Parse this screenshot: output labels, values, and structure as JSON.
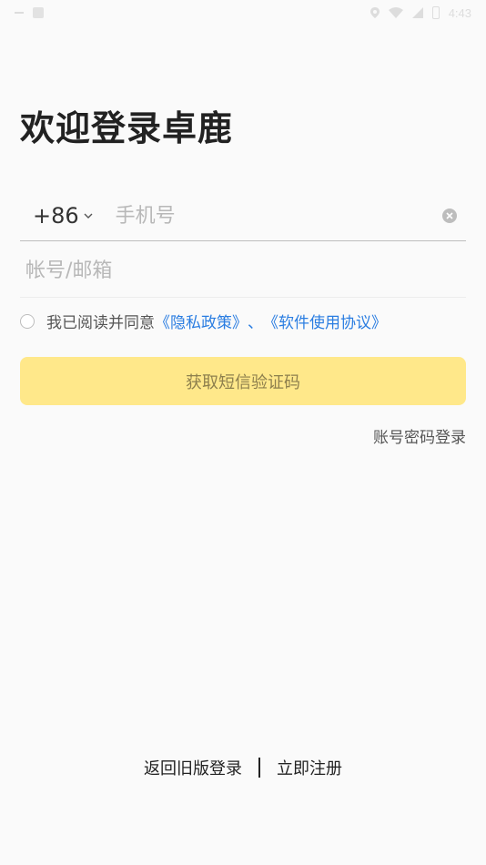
{
  "status_bar": {
    "time": "4:43",
    "icons": [
      "minus-icon",
      "image-icon",
      "location-icon",
      "wifi-icon",
      "signal-icon",
      "battery-icon"
    ]
  },
  "title": "欢迎登录卓鹿",
  "phone": {
    "country_code": "+86",
    "placeholder": "手机号"
  },
  "account": {
    "placeholder": "帐号/邮箱"
  },
  "agreement": {
    "prefix": "我已阅读并同意",
    "privacy_link": "《隐私政策》",
    "separator": "、",
    "terms_link": "《软件使用协议》"
  },
  "sms_button": {
    "label": "获取短信验证码",
    "bg_color": "#ffe88a"
  },
  "password_login": "账号密码登录",
  "bottom": {
    "old_login": "返回旧版登录",
    "register": "立即注册"
  },
  "colors": {
    "link": "#2a7de1",
    "background": "#fafafa"
  }
}
